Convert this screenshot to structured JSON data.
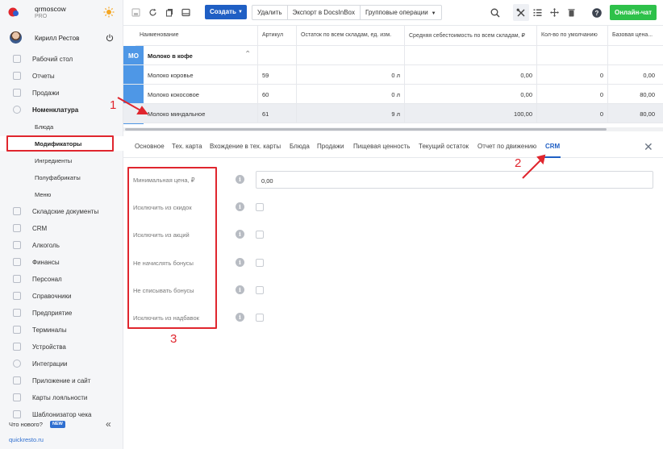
{
  "brand": {
    "name": "qrmoscow",
    "plan": "PRO"
  },
  "user": {
    "name": "Кирилл Рестов"
  },
  "nav": [
    {
      "label": "Рабочий стол"
    },
    {
      "label": "Отчеты"
    },
    {
      "label": "Продажи"
    },
    {
      "label": "Номенклатура"
    },
    {
      "label": "Блюда"
    },
    {
      "label": "Модификаторы"
    },
    {
      "label": "Ингредиенты"
    },
    {
      "label": "Полуфабрикаты"
    },
    {
      "label": "Меню"
    },
    {
      "label": "Складские документы"
    },
    {
      "label": "CRM"
    },
    {
      "label": "Алкоголь"
    },
    {
      "label": "Финансы"
    },
    {
      "label": "Персонал"
    },
    {
      "label": "Справочники"
    },
    {
      "label": "Предприятие"
    },
    {
      "label": "Терминалы"
    },
    {
      "label": "Устройства"
    },
    {
      "label": "Интеграции"
    },
    {
      "label": "Приложение и сайт"
    },
    {
      "label": "Карты лояльности"
    },
    {
      "label": "Шаблонизатор чека"
    }
  ],
  "footer": {
    "whats_new": "Что нового?",
    "new_badge": "NEW",
    "site": "quickresto.ru"
  },
  "toolbar": {
    "create": "Создать",
    "delete": "Удалить",
    "export": "Экспорт в DocsInBox",
    "group_ops": "Групповые операции",
    "chat": "Онлайн-чат"
  },
  "table": {
    "columns": [
      "Наименование",
      "Артикул",
      "Остаток по всем складам, ед. изм.",
      "Средняя себестоимость по всем складам, ₽",
      "Кол-во по умолчанию",
      "Базовая цена..."
    ],
    "group": {
      "tag": "МО",
      "name": "Молоко в кофе"
    },
    "rows": [
      {
        "name": "Молоко коровье",
        "article": "59",
        "stock": "0 л",
        "cost": "0,00",
        "qty": "0",
        "price": "0,00"
      },
      {
        "name": "Молоко кокосовое",
        "article": "60",
        "stock": "0 л",
        "cost": "0,00",
        "qty": "0",
        "price": "80,00"
      },
      {
        "name": "Молоко миндальное",
        "article": "61",
        "stock": "9 л",
        "cost": "100,00",
        "qty": "0",
        "price": "80,00"
      }
    ]
  },
  "tabs": [
    "Основное",
    "Тех. карта",
    "Вхождение в тех. карты",
    "Блюда",
    "Продажи",
    "Пищевая ценность",
    "Текущий остаток",
    "Отчет по движению",
    "CRM"
  ],
  "form": {
    "min_price_label": "Минимальная цена, ₽",
    "min_price_value": "0,00",
    "fields": [
      "Исключить из скидок",
      "Исключить из акций",
      "Не начислять бонусы",
      "Не списывать бонусы",
      "Исключить из надбавок"
    ]
  },
  "annotations": [
    "1",
    "2",
    "3"
  ],
  "colors": {
    "accent": "#1f5fc4",
    "chat": "#2ec14a",
    "annotation": "#e0262e",
    "group_tag": "#4e97e6"
  }
}
